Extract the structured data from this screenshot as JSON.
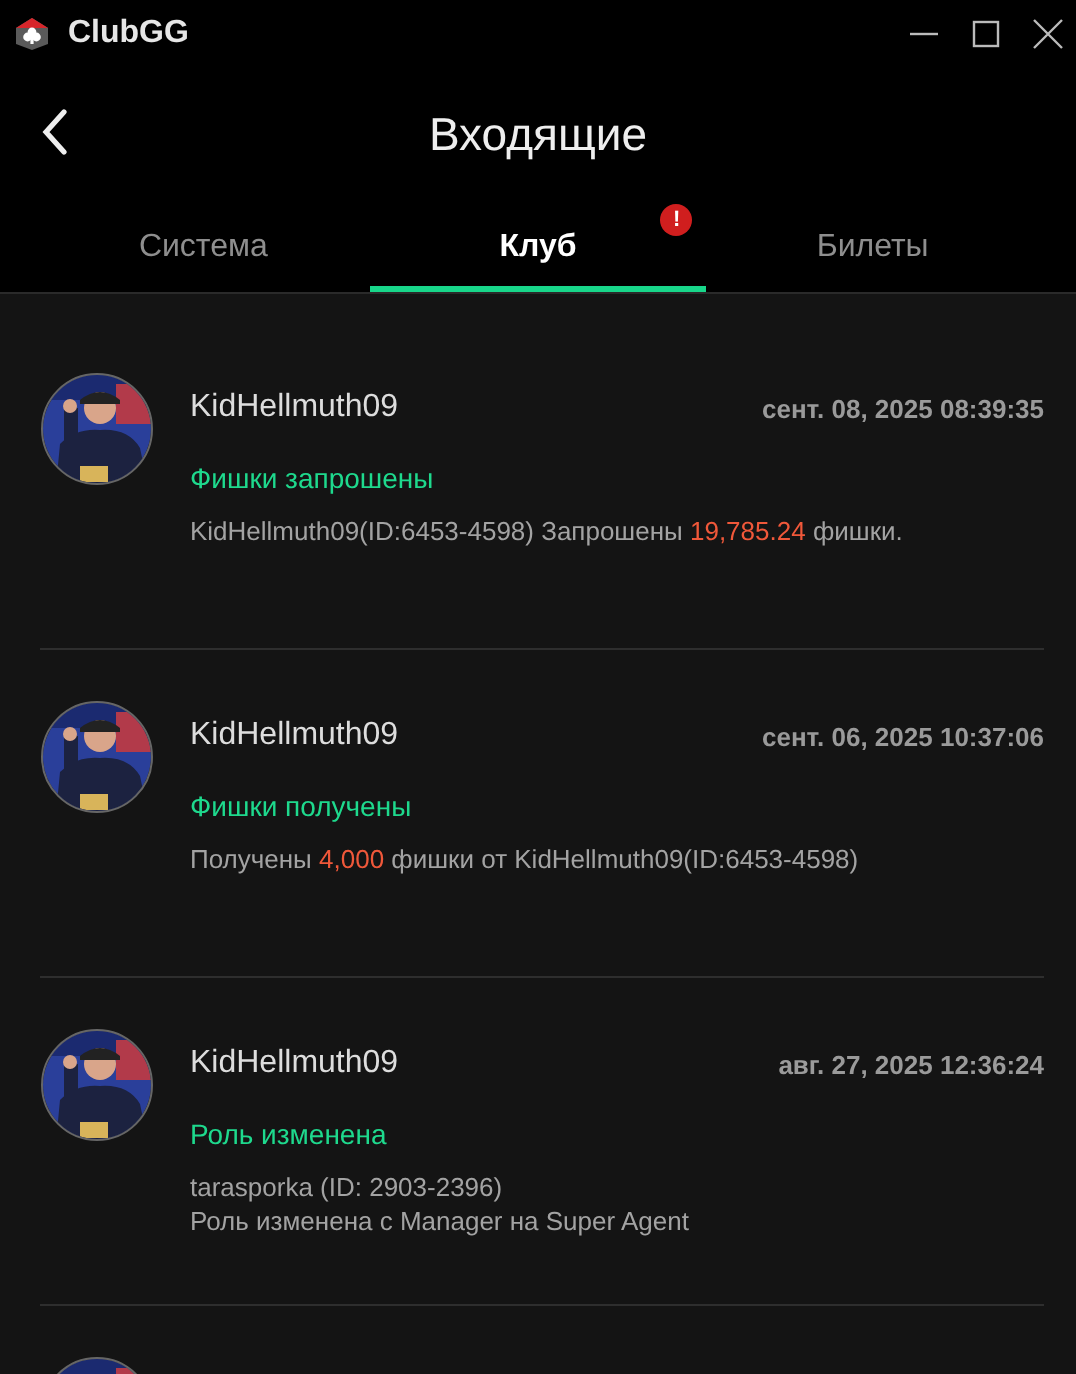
{
  "window": {
    "app_name": "ClubGG"
  },
  "header": {
    "title": "Входящие"
  },
  "tabs": [
    {
      "label": "Система",
      "selected": false
    },
    {
      "label": "Клуб",
      "selected": true,
      "badge": "!"
    },
    {
      "label": "Билеты",
      "selected": false
    }
  ],
  "messages": [
    {
      "kind": "message",
      "sender": "KidHellmuth09",
      "time": "сент. 08, 2025 08:39:35",
      "subject": "Фишки запрошены",
      "lines": [
        [
          {
            "text": "KidHellmuth09(ID:6453-4598) Запрошены ",
            "highlight": false
          },
          {
            "text": "19,785.24",
            "highlight": true
          },
          {
            "text": " фишки.",
            "highlight": false
          }
        ]
      ]
    },
    {
      "kind": "message",
      "sender": "KidHellmuth09",
      "time": "сент. 06, 2025 10:37:06",
      "subject": "Фишки получены",
      "lines": [
        [
          {
            "text": "Получены ",
            "highlight": false
          },
          {
            "text": "4,000",
            "highlight": true
          },
          {
            "text": " фишки от KidHellmuth09(ID:6453-4598)",
            "highlight": false
          }
        ]
      ]
    },
    {
      "kind": "message",
      "sender": "KidHellmuth09",
      "time": "авг. 27, 2025 12:36:24",
      "subject": "Роль изменена",
      "lines": [
        [
          {
            "text": "tarasporka (ID: 2903-2396)",
            "highlight": false
          }
        ],
        [
          {
            "text": "Роль изменена с Manager на Super Agent",
            "highlight": false
          }
        ]
      ]
    },
    {
      "kind": "cut_off"
    }
  ]
}
